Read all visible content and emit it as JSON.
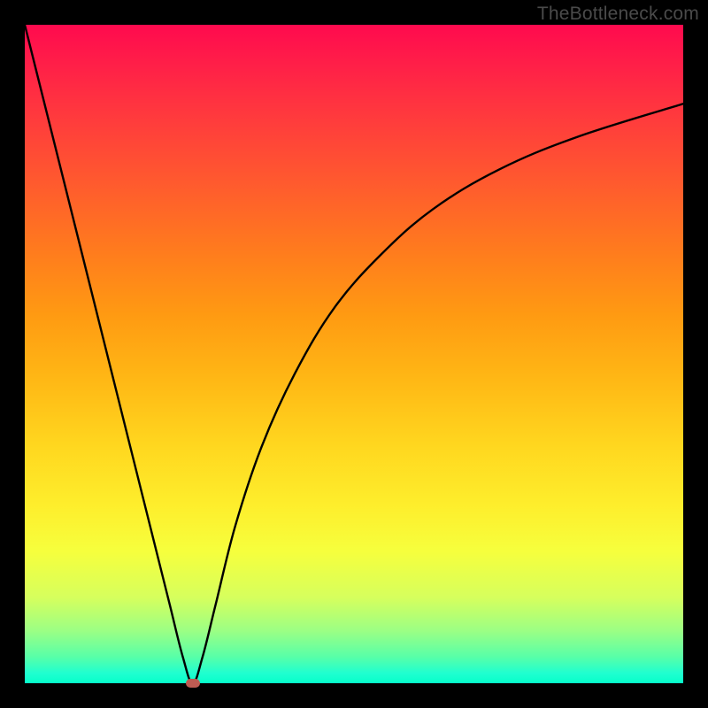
{
  "watermark": "TheBottleneck.com",
  "chart_data": {
    "type": "line",
    "title": "",
    "xlabel": "",
    "ylabel": "",
    "xlim": [
      0,
      100
    ],
    "ylim": [
      0,
      100
    ],
    "grid": false,
    "series": [
      {
        "name": "bottleneck-curve",
        "x": [
          0,
          4,
          8,
          12,
          16,
          20,
          22,
          24,
          25.5,
          27,
          29,
          32,
          36,
          41,
          47,
          54,
          62,
          72,
          84,
          100
        ],
        "y": [
          100,
          84,
          68,
          52,
          36,
          20,
          12,
          4,
          0,
          4,
          12,
          24,
          36,
          47,
          57,
          65,
          72,
          78,
          83,
          88
        ],
        "color": "#000000"
      }
    ],
    "marker": {
      "x": 25.5,
      "y": 0,
      "color": "#bd5b52"
    },
    "background_gradient": {
      "stops": [
        {
          "pos": 0,
          "color": "#ff0a4e"
        },
        {
          "pos": 24,
          "color": "#ff5a2e"
        },
        {
          "pos": 54,
          "color": "#ffb815"
        },
        {
          "pos": 80,
          "color": "#f6ff3d"
        },
        {
          "pos": 100,
          "color": "#06ffca"
        }
      ]
    }
  }
}
